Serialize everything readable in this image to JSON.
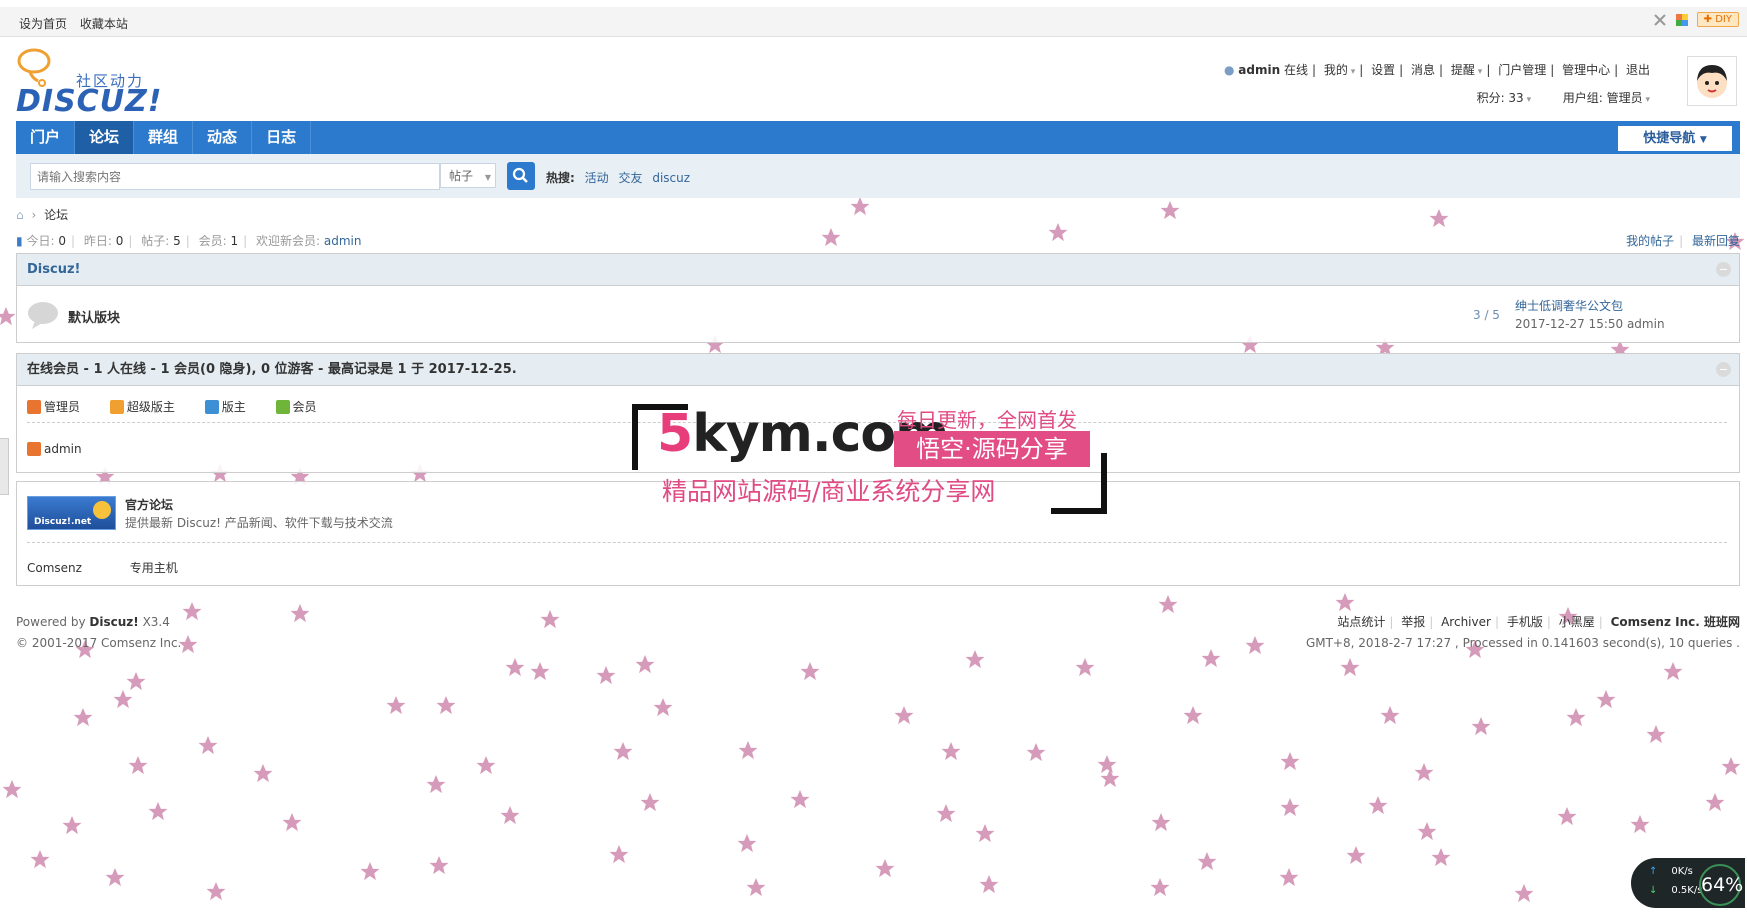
{
  "toolbar": {
    "set_homepage": "设为首页",
    "bookmark": "收藏本站",
    "diy": "DIY"
  },
  "logo": {
    "slogan": "社区动力",
    "word": "DISCUZ!"
  },
  "user": {
    "name": "admin",
    "status": "在线",
    "menu": [
      "我的",
      "设置",
      "消息",
      "提醒",
      "门户管理",
      "管理中心",
      "退出"
    ],
    "points_label": "积分: 33",
    "group_label": "用户组: 管理员"
  },
  "nav": {
    "items": [
      "门户",
      "论坛",
      "群组",
      "动态",
      "日志"
    ],
    "active": "论坛",
    "quicknav": "快捷导航"
  },
  "search": {
    "placeholder": "请输入搜索内容",
    "type": "帖子",
    "hot_label": "热搜:",
    "hot_words": [
      "活动",
      "交友",
      "discuz"
    ]
  },
  "breadcrumb": {
    "current": "论坛"
  },
  "stats": {
    "today_label": "今日:",
    "today": "0",
    "yesterday_label": "昨日:",
    "yesterday": "0",
    "posts_label": "帖子:",
    "posts": "5",
    "members_label": "会员:",
    "members": "1",
    "welcome_label": "欢迎新会员:",
    "newest_member": "admin"
  },
  "rightlinks": [
    "我的帖子",
    "最新回复"
  ],
  "forum_group": {
    "title": "Discuz!",
    "forums": [
      {
        "name": "默认版块",
        "count": "3 / 5",
        "last_title": "绅士低调奢华公文包",
        "last_meta": "2017-12-27 15:50 admin"
      }
    ]
  },
  "online": {
    "title": "在线会员 - 1 人在线 - 1 会员(0 隐身), 0 位游客 - 最高记录是 1 于 2017-12-25.",
    "legend": [
      {
        "label": "管理员",
        "color": "#e9742f"
      },
      {
        "label": "超级版主",
        "color": "#f0a030"
      },
      {
        "label": "版主",
        "color": "#3d8fd6"
      },
      {
        "label": "会员",
        "color": "#6fb53a"
      }
    ],
    "users": [
      "admin"
    ]
  },
  "links": {
    "logo_text": "Discuz!.net",
    "title": "官方论坛",
    "desc": "提供最新 Discuz! 产品新闻、软件下载与技术交流",
    "text_links": [
      "Comsenz",
      "专用主机"
    ]
  },
  "footer": {
    "powered_prefix": "Powered by",
    "powered_brand": "Discuz!",
    "version": "X3.4",
    "copyright": "© 2001-2017 Comsenz Inc.",
    "links": [
      "站点统计",
      "举报",
      "Archiver",
      "手机版",
      "小黑屋"
    ],
    "brand": "Comsenz Inc. 班班网",
    "processed": "GMT+8, 2018-2-7 17:27 , Processed in 0.141603 second(s), 10 queries ."
  },
  "watermark": {
    "domain_num": "5",
    "domain_rest": "kym.com",
    "tag1": "每日更新，全网首发",
    "tag2": "悟空·源码分享",
    "tag3": "精品网站源码/商业系统分享网"
  },
  "speed": {
    "up": "0K/s",
    "down": "0.5K/s",
    "percent": "64%"
  },
  "colors": {
    "nav": "#2b7acd",
    "link": "#336699",
    "star": "#c97aa3"
  }
}
